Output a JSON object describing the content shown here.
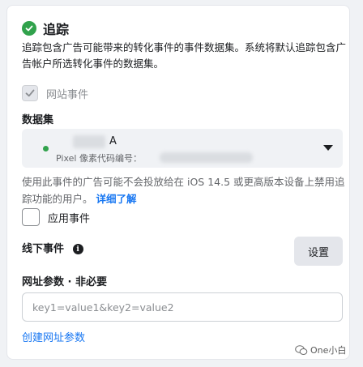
{
  "header": {
    "title": "追踪",
    "description": "追踪包含广告可能带来的转化事件的事件数据集。系统将默认追踪包含广告帐户所选转化事件的数据集。"
  },
  "website_events": {
    "label": "网站事件",
    "checked": true,
    "disabled": true
  },
  "dataset": {
    "section_label": "数据集",
    "selected_name_visible": "A",
    "pixel_label": "Pixel 像素代码编号："
  },
  "warning": {
    "text": "使用此事件的广告可能不会投放给在 iOS 14.5 或更高版本设备上禁用追踪功能的用户。",
    "link": "详细了解"
  },
  "app_events": {
    "label": "应用事件",
    "checked": false
  },
  "offline_events": {
    "label": "线下事件",
    "setup_button": "设置"
  },
  "url_params": {
    "label": "网址参数 · 非必要",
    "placeholder": "key1=value1&key2=value2",
    "create_link": "创建网址参数"
  },
  "watermark": {
    "text": "One小白"
  },
  "colors": {
    "success": "#31a24c",
    "link": "#1877f2",
    "background": "#f0f2f5"
  }
}
